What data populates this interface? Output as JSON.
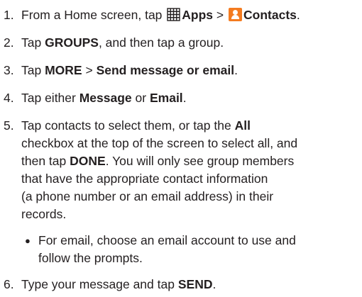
{
  "steps": [
    {
      "num": "1.",
      "pre": "From a Home screen, tap",
      "apps_label": "Apps",
      "sep": ">",
      "contacts_label": "Contacts",
      "end": "."
    },
    {
      "num": "2.",
      "pre": "Tap",
      "b1": "GROUPS",
      "post": ", and then tap a group."
    },
    {
      "num": "3.",
      "pre": "Tap",
      "b1": "MORE",
      "sep": ">",
      "b2": "Send message or email",
      "end": "."
    },
    {
      "num": "4.",
      "pre": "Tap either",
      "b1": "Message",
      "mid": "or",
      "b2": "Email",
      "end": "."
    },
    {
      "num": "5.",
      "line1_pre": "Tap contacts to select them, or tap the",
      "line1_b": "All",
      "line2": "checkbox at the top of the screen to select all, and",
      "line3_pre": "then tap",
      "line3_b": "DONE",
      "line3_post": ". You will only see group members",
      "line4": "that have the appropriate contact information",
      "line5": "(a phone number or an email address) in their",
      "line6": "records."
    },
    {
      "num": "6.",
      "pre": "Type your message and tap",
      "b1": "SEND",
      "end": "."
    }
  ],
  "bullet": {
    "dot": "●",
    "line1": "For email, choose an email account to use and",
    "line2": "follow the prompts."
  },
  "icons": {
    "apps": "apps-grid-icon",
    "contacts": "contacts-icon",
    "contacts_color": "#f47b20"
  }
}
